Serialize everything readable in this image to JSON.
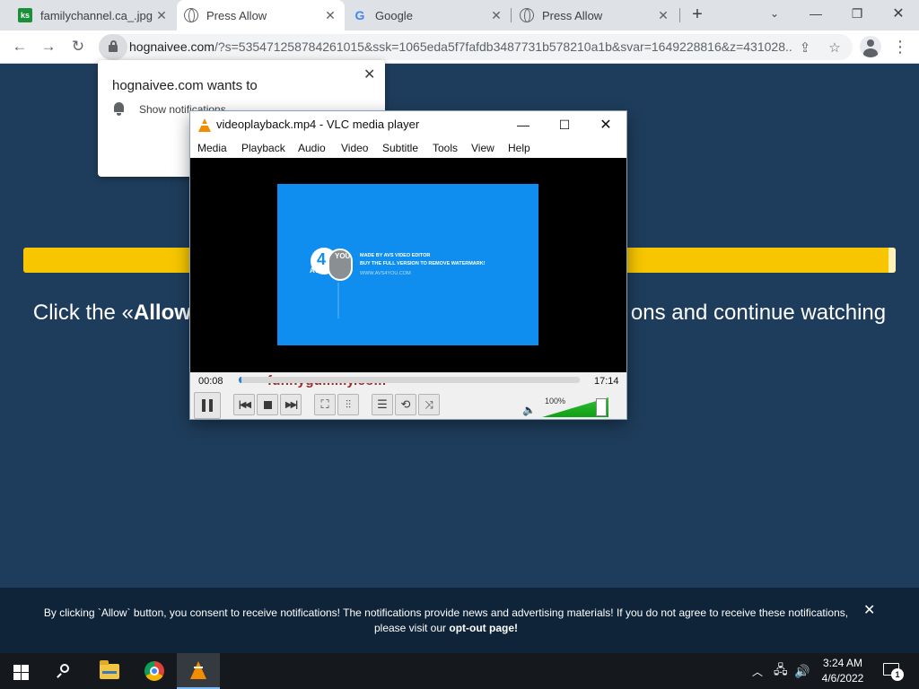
{
  "browser": {
    "tabs": [
      {
        "title": "familychannel.ca_.jpg (",
        "favicon": "ks-logo-icon",
        "active": false
      },
      {
        "title": "Press Allow",
        "favicon": "globe-icon",
        "active": true
      },
      {
        "title": "Google",
        "favicon": "google-g-icon",
        "active": false
      },
      {
        "title": "Press Allow",
        "favicon": "globe-icon",
        "active": false
      }
    ],
    "url_host": "hognaivee.com",
    "url_rest": "/?s=535471258784261015&ssk=1065eda5f7fafdb3487731b578210a1b&svar=1649228816&z=431028..."
  },
  "permission_popup": {
    "title": "hognaivee.com wants to",
    "option": "Show notifications"
  },
  "page": {
    "headline_pre": "Click the «",
    "headline_bold": "Allow",
    "headline_post": "ons and continue watching",
    "progress_bar_color": "#f7c600"
  },
  "footer": {
    "text_pre": "By clicking `Allow` button, you consent to receive notifications! The notifications provide news and advertising materials! If you do not agree to receive these notifications, please visit our ",
    "link": "opt-out page",
    "text_post": "!"
  },
  "vlc": {
    "title": "videoplayback.mp4 - VLC media player",
    "menus": [
      "Media",
      "Playback",
      "Audio",
      "Video",
      "Subtitle",
      "Tools",
      "View",
      "Help"
    ],
    "watermark_lines": [
      "MADE BY AVS VIDEO EDITOR",
      "BUY THE FULL VERSION TO REMOVE WATERMARK!",
      "WWW.AVS4YOU.COM"
    ],
    "watermark_avs": "AVS",
    "watermark_4": "4",
    "watermark_you": "YOU",
    "overlay_text": "funnygummy.com",
    "elapsed": "00:08",
    "duration": "17:14",
    "progress_fraction": 0.008,
    "volume_label": "100%",
    "volume_fraction": 1.0
  },
  "taskbar": {
    "time": "3:24 AM",
    "date": "4/6/2022",
    "notification_count": "1"
  }
}
